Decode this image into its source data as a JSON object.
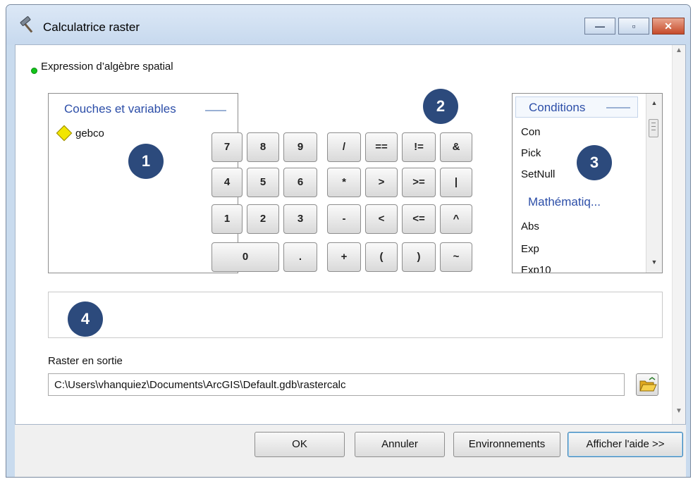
{
  "window": {
    "title": "Calculatrice raster"
  },
  "expression_label": "Expression d’algèbre spatial",
  "layers": {
    "header": "Couches et variables",
    "items": [
      "gebco"
    ]
  },
  "keypad": {
    "numbers": [
      "7",
      "8",
      "9",
      "4",
      "5",
      "6",
      "1",
      "2",
      "3",
      "0",
      "."
    ],
    "operators": [
      "/",
      "==",
      "!=",
      "&",
      "*",
      ">",
      ">=",
      "|",
      "-",
      "<",
      "<=",
      "^",
      "+",
      "(",
      ")",
      "~"
    ]
  },
  "functions": {
    "groups": [
      {
        "header": "Conditions",
        "items": [
          "Con",
          "Pick",
          "SetNull"
        ]
      },
      {
        "header": "Mathématiq...",
        "items": [
          "Abs",
          "Exp",
          "Exp10"
        ]
      }
    ]
  },
  "callouts": [
    "1",
    "2",
    "3",
    "4"
  ],
  "output": {
    "label": "Raster en sortie",
    "value": "C:\\Users\\vhanquiez\\Documents\\ArcGIS\\Default.gdb\\rastercalc"
  },
  "buttons": {
    "ok": "OK",
    "cancel": "Annuler",
    "environments": "Environnements",
    "help": "Afficher l'aide >>"
  },
  "colors": {
    "callout": "#2c4a7c",
    "section_header": "#2c4ea8",
    "status_dot": "#12c41a"
  },
  "icons": {
    "app": "hammer-icon",
    "browse": "open-folder-icon",
    "layer": "raster-layer-icon",
    "status": "green-dot-icon"
  }
}
